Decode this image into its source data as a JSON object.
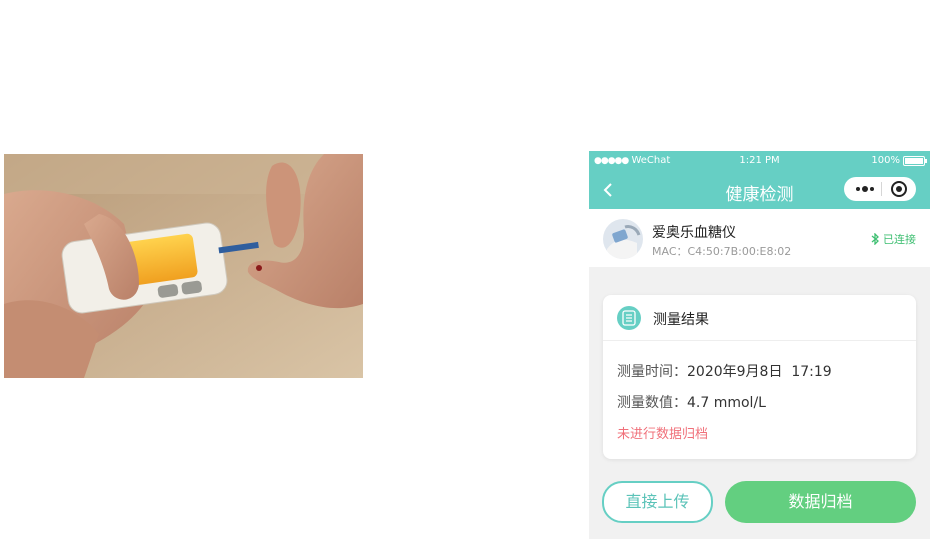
{
  "status_bar": {
    "carrier_dots": "●●●●●",
    "carrier": "WeChat",
    "time": "1:21 PM",
    "battery": "100%"
  },
  "nav": {
    "title": "健康检测",
    "back_icon": "chevron-left-icon",
    "more_icon": "more-dots-icon",
    "close_icon": "target-circle-icon"
  },
  "device": {
    "name": "爱奥乐血糖仪",
    "mac": "MAC：C4:50:7B:00:E8:02",
    "status": "已连接",
    "status_icon": "bluetooth-icon"
  },
  "result": {
    "title": "测量结果",
    "time_label": "测量时间：",
    "time_value": "2020年9月8日  17:19",
    "value_label": "测量数值：",
    "value": "4.7 mmol/L",
    "note": "未进行数据归档"
  },
  "actions": {
    "upload": "直接上传",
    "archive": "数据归档"
  },
  "colors": {
    "accent": "#66cfc4",
    "success": "#63cf80",
    "warning": "#f0707a"
  }
}
